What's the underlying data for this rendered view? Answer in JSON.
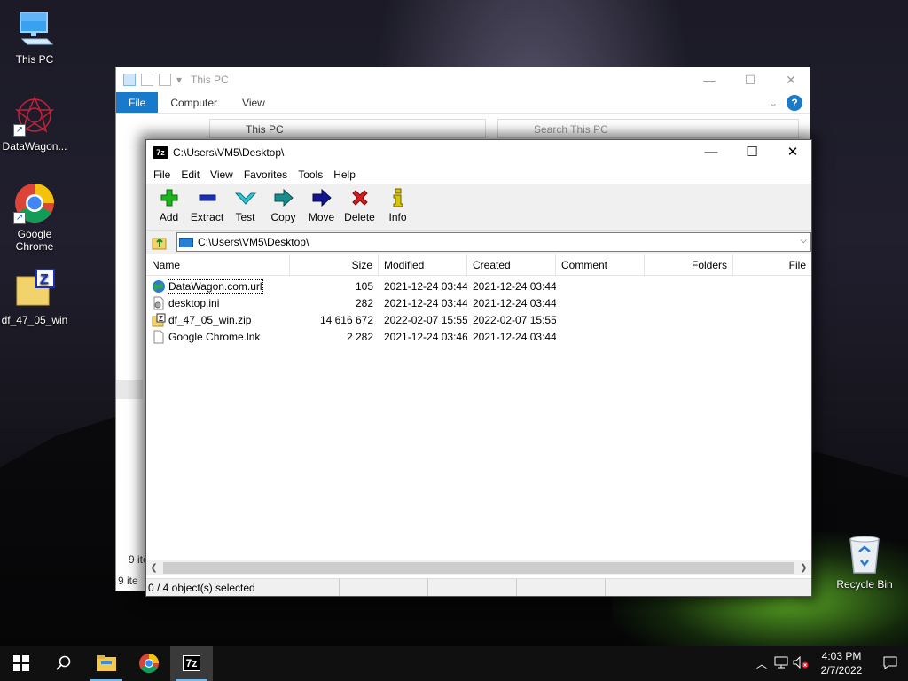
{
  "desktop": {
    "icons": [
      {
        "label": "This PC"
      },
      {
        "label": "DataWagon..."
      },
      {
        "label": "Google Chrome"
      },
      {
        "label": "df_47_05_win"
      }
    ],
    "recycle_bin": "Recycle Bin"
  },
  "explorer": {
    "title": "This PC",
    "ribbon_tabs": [
      "File",
      "Computer",
      "View"
    ],
    "address": "This PC",
    "search_placeholder": "Search This PC",
    "status": "9 items",
    "status_partial": "9 ite"
  },
  "sevenzip": {
    "title": "C:\\Users\\VM5\\Desktop\\",
    "app_icon_text": "7z",
    "menu": [
      "File",
      "Edit",
      "View",
      "Favorites",
      "Tools",
      "Help"
    ],
    "toolbar": [
      {
        "label": "Add",
        "icon": "plus-icon",
        "color": "#1db31d"
      },
      {
        "label": "Extract",
        "icon": "minus-icon",
        "color": "#1b2fb4"
      },
      {
        "label": "Test",
        "icon": "check-icon",
        "color": "#2cc6d6"
      },
      {
        "label": "Copy",
        "icon": "copy-arrow-icon",
        "color": "#1a8c8c"
      },
      {
        "label": "Move",
        "icon": "move-arrow-icon",
        "color": "#14148c"
      },
      {
        "label": "Delete",
        "icon": "delete-x-icon",
        "color": "#d31f1f"
      },
      {
        "label": "Info",
        "icon": "info-icon",
        "color": "#d8c400"
      }
    ],
    "path": "C:\\Users\\VM5\\Desktop\\",
    "columns": [
      "Name",
      "Size",
      "Modified",
      "Created",
      "Comment",
      "Folders",
      "File"
    ],
    "files": [
      {
        "name": "DataWagon.com.url",
        "size": "105",
        "modified": "2021-12-24 03:44",
        "created": "2021-12-24 03:44",
        "icon": "globe-icon"
      },
      {
        "name": "desktop.ini",
        "size": "282",
        "modified": "2021-12-24 03:44",
        "created": "2021-12-24 03:44",
        "icon": "settings-file-icon"
      },
      {
        "name": "df_47_05_win.zip",
        "size": "14 616 672",
        "modified": "2022-02-07 15:55",
        "created": "2022-02-07 15:55",
        "icon": "zip-file-icon"
      },
      {
        "name": "Google Chrome.lnk",
        "size": "2 282",
        "modified": "2021-12-24 03:46",
        "created": "2021-12-24 03:44",
        "icon": "file-icon"
      }
    ],
    "status": "0 / 4 object(s) selected"
  },
  "taskbar": {
    "time": "4:03 PM",
    "date": "2/7/2022"
  }
}
